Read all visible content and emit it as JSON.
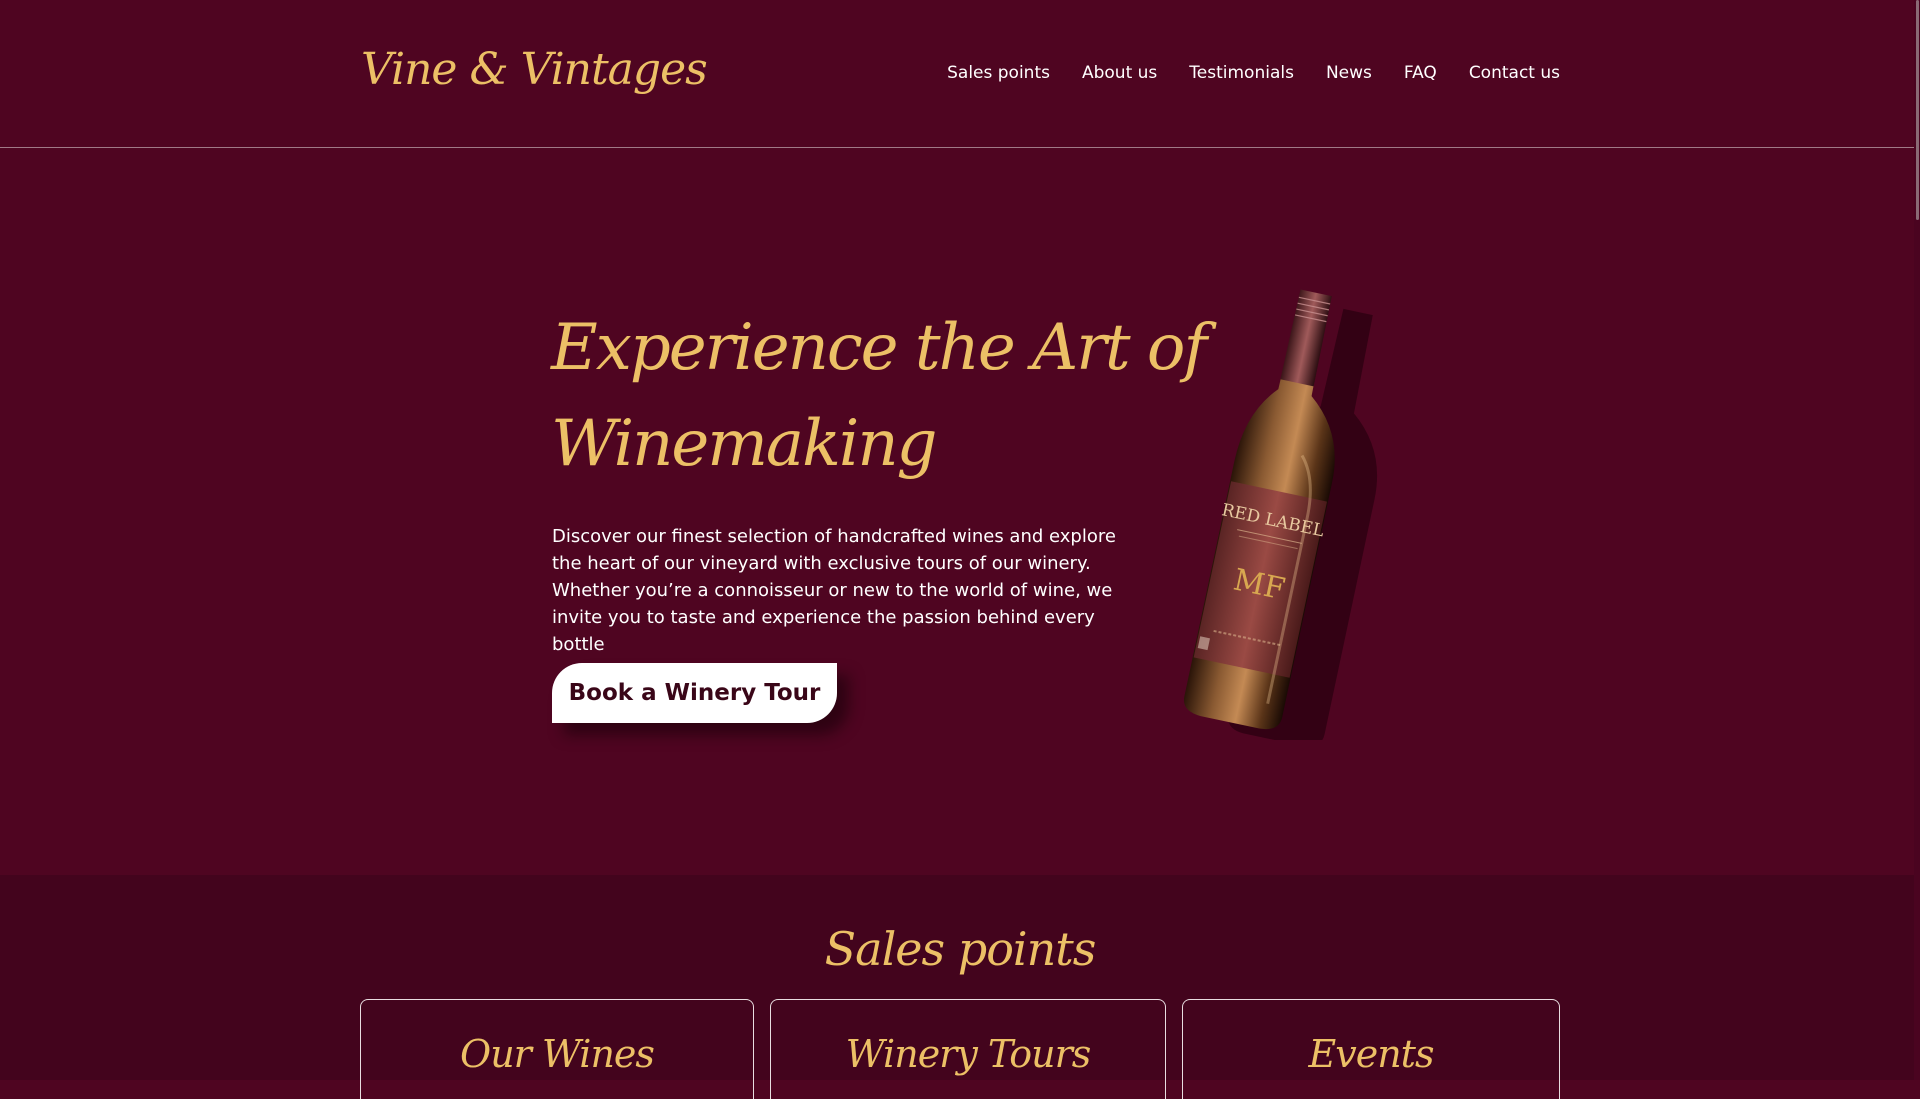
{
  "brand": {
    "name": "Vine & Vintages"
  },
  "nav": {
    "items": [
      "Sales points",
      "About us",
      "Testimonials",
      "News",
      "FAQ",
      "Contact us"
    ]
  },
  "hero": {
    "title_line1": "Experience the Art of",
    "title_line2": "Winemaking",
    "description": "Discover our finest selection of handcrafted wines and explore the heart of our vineyard with exclusive tours of our winery. Whether you’re a connoisseur or new to the world of wine, we invite you to taste and experience the passion behind every bottle",
    "cta_label": "Book a Winery Tour"
  },
  "bottle": {
    "label_title": "RED LABEL",
    "label_monogram": "MF"
  },
  "sales_points": {
    "title": "Sales points",
    "cards": [
      "Our Wines",
      "Winery Tours",
      "Events"
    ]
  },
  "colors": {
    "background": "#4f0521",
    "section_background": "#43041d",
    "accent_gold": "#ecc066",
    "text": "#ffffff"
  }
}
